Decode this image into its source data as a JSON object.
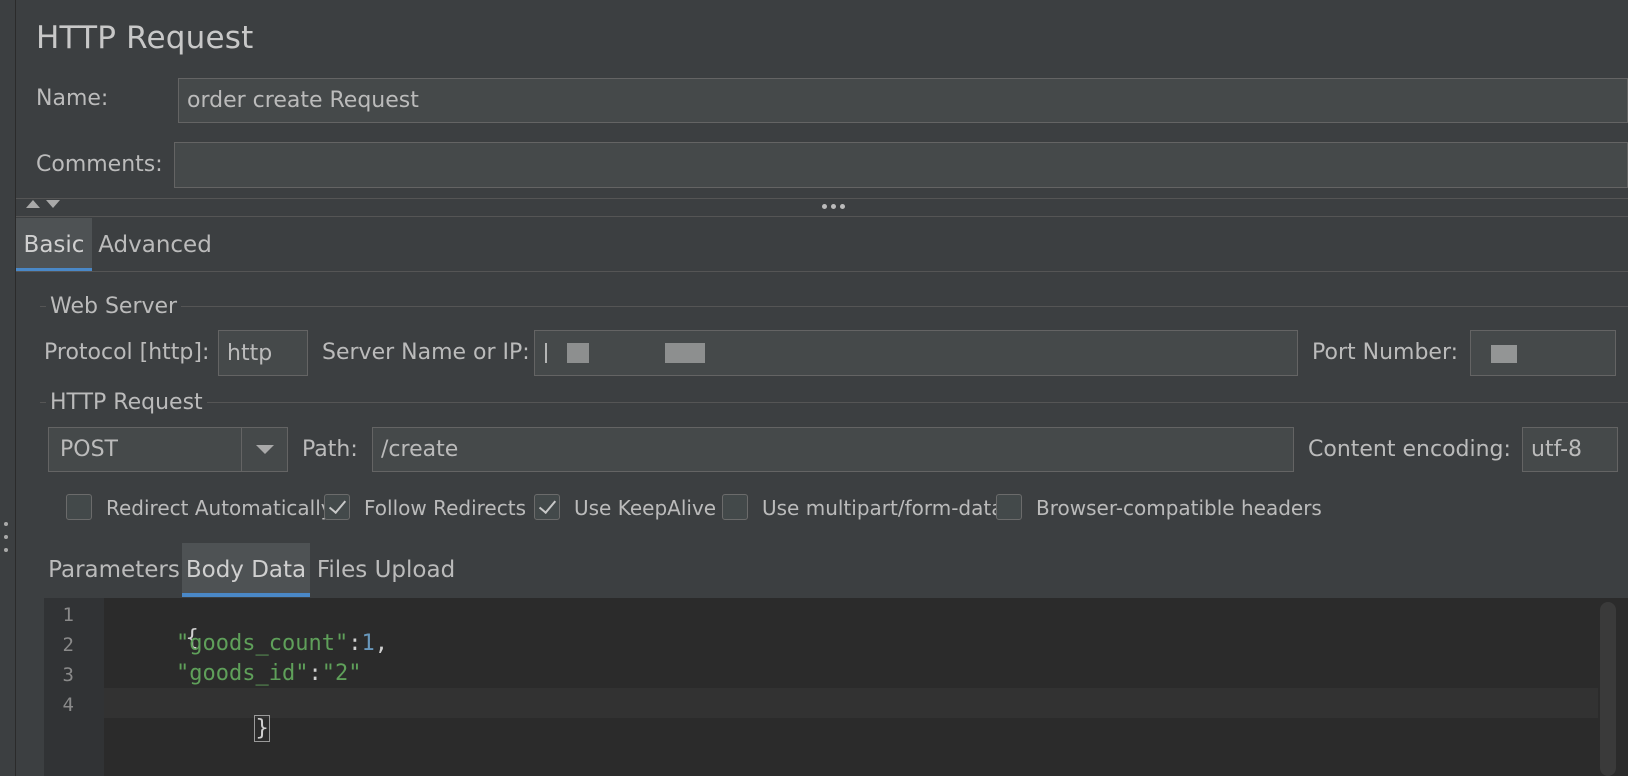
{
  "panel": {
    "title": "HTTP Request"
  },
  "fields": {
    "name_label": "Name:",
    "name_value": "order create Request",
    "comments_label": "Comments:",
    "comments_value": ""
  },
  "tabs": {
    "main": [
      {
        "label": "Basic",
        "active": true
      },
      {
        "label": "Advanced",
        "active": false
      }
    ]
  },
  "web_server": {
    "group_title": "Web Server",
    "protocol_label": "Protocol [http]:",
    "protocol_value": "http",
    "server_label": "Server Name or IP:",
    "server_value": "",
    "port_label": "Port Number:",
    "port_value": ""
  },
  "http_request": {
    "group_title": "HTTP Request",
    "method": "POST",
    "path_label": "Path:",
    "path_value": "/create",
    "encoding_label": "Content encoding:",
    "encoding_value": "utf-8"
  },
  "options": [
    {
      "label": "Redirect Automatically",
      "checked": false
    },
    {
      "label": "Follow Redirects",
      "checked": true
    },
    {
      "label": "Use KeepAlive",
      "checked": true
    },
    {
      "label": "Use multipart/form-data",
      "checked": false
    },
    {
      "label": "Browser-compatible headers",
      "checked": false
    }
  ],
  "sub_tabs": [
    {
      "label": "Parameters",
      "active": false
    },
    {
      "label": "Body Data",
      "active": true
    },
    {
      "label": "Files Upload",
      "active": false
    }
  ],
  "editor": {
    "line_numbers": [
      "1",
      "2",
      "3",
      "4"
    ],
    "lines": {
      "l1_brace": "{",
      "l2_key": "\"goods_count\"",
      "l2_colon": ":",
      "l2_value": "1",
      "l2_comma": ",",
      "l3_key": "\"goods_id\"",
      "l3_colon": ":",
      "l3_value": "\"2\"",
      "l4_brace": "}"
    }
  },
  "colors": {
    "background": "#3c3f41",
    "field_bg": "#45494a",
    "accent_tab": "#4a88c7",
    "editor_bg": "#2b2b2b",
    "string_green": "#6a8759",
    "number_blue": "#6897bb"
  }
}
